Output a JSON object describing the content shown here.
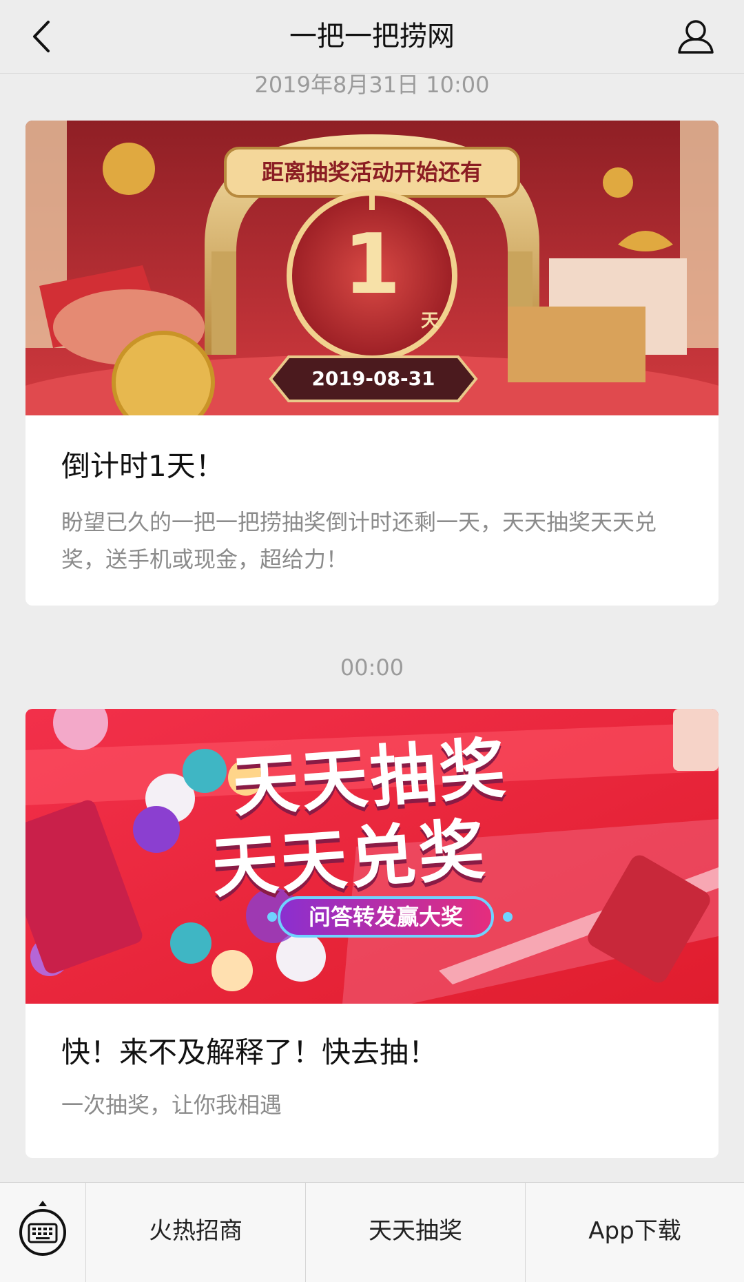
{
  "nav": {
    "title": "一把一把捞网",
    "back_icon": "chevron-left-icon",
    "user_icon": "user-icon"
  },
  "messages": [
    {
      "timestamp": "2019年8月31日 10:00",
      "banner": {
        "top_ribbon": "距离抽奖活动开始还有",
        "countdown_number": "1",
        "countdown_unit": "天",
        "date_badge": "2019-08-31"
      },
      "title": "倒计时1天！",
      "description": "盼望已久的一把一把捞抽奖倒计时还剩一天，天天抽奖天天兑奖，送手机或现金，超给力！"
    },
    {
      "timestamp": "00:00",
      "banner": {
        "headline_1": "天天抽奖",
        "headline_2": "天天兑奖",
        "pill": "问答转发赢大奖"
      },
      "title": "快！来不及解释了！快去抽！",
      "description": "一次抽奖，让你我相遇"
    }
  ],
  "tabbar": {
    "keyboard_icon": "keyboard-icon",
    "items": [
      "火热招商",
      "天天抽奖",
      "App下载"
    ]
  },
  "colors": {
    "background": "#ededed",
    "banner1_red": "#b8292e",
    "gold": "#d8b06a",
    "banner2_red": "#e8283a"
  }
}
